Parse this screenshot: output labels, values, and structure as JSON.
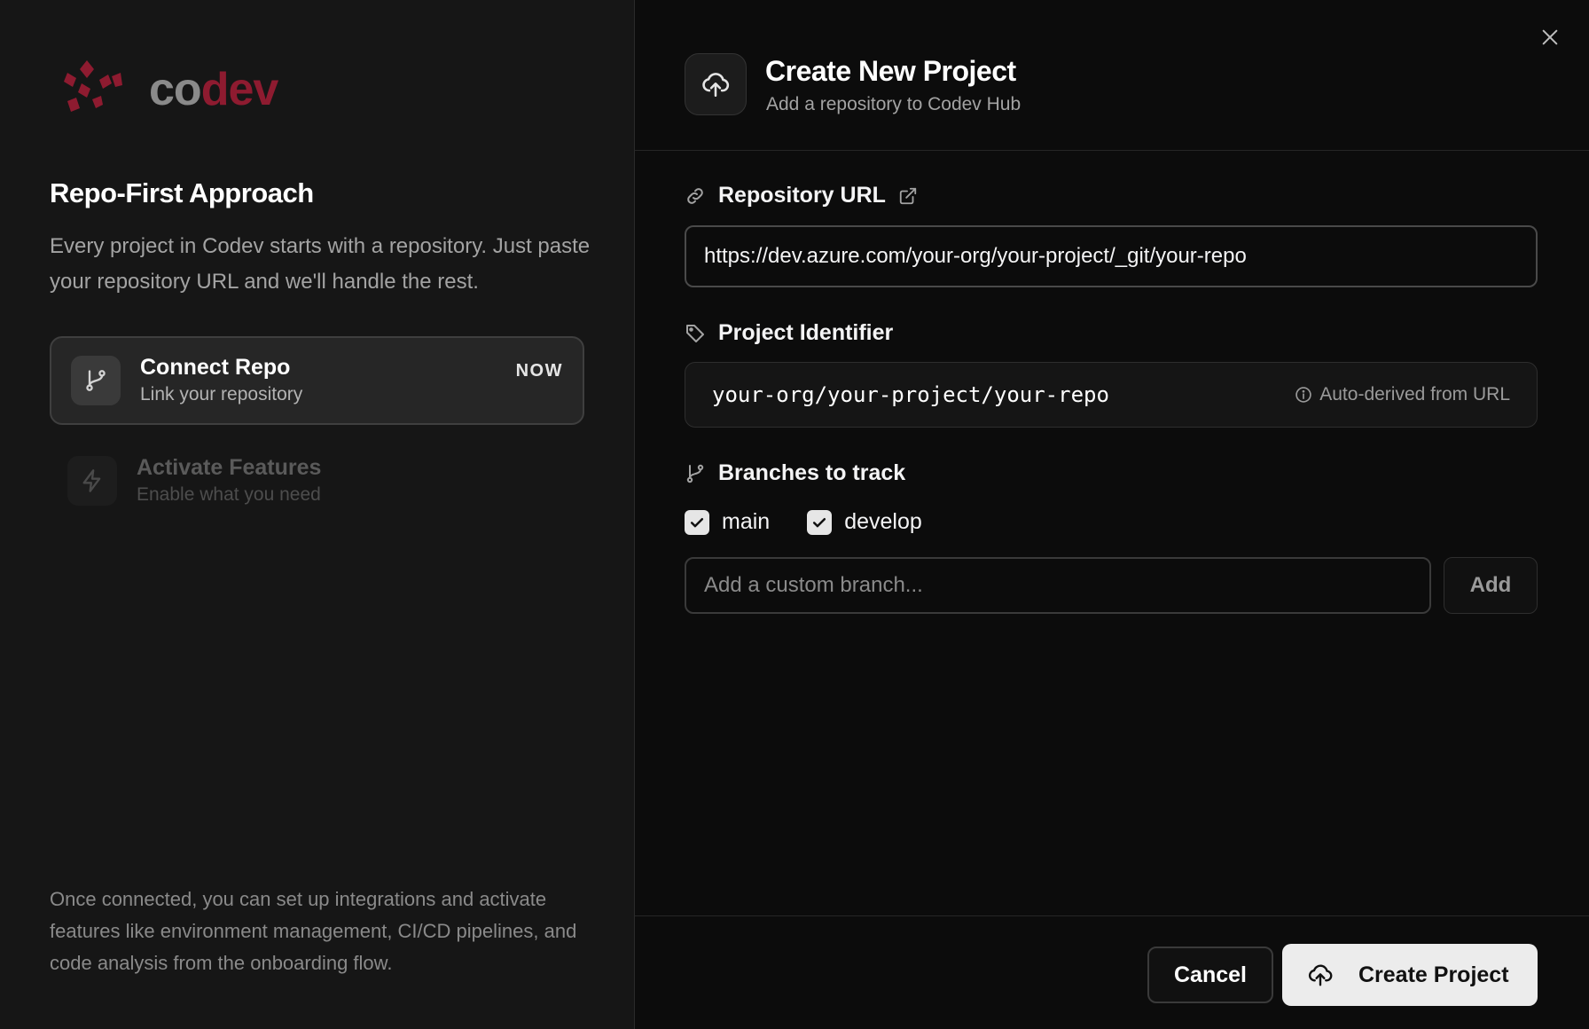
{
  "brand": {
    "logo_text_a": "co",
    "logo_text_b": "dev",
    "logo_icon": "codev-logo-icon",
    "accent_color": "#8e1b30"
  },
  "left": {
    "title": "Repo-First Approach",
    "intro": "Every project in Codev starts with a repository. Just paste your repository URL and we'll handle the rest.",
    "steps": [
      {
        "title": "Connect Repo",
        "subtitle": "Link your repository",
        "badge": "NOW",
        "icon": "git-branch-icon",
        "active": true
      },
      {
        "title": "Activate Features",
        "subtitle": "Enable what you need",
        "icon": "lightning-icon",
        "active": false
      }
    ],
    "outro": "Once connected, you can set up integrations and activate features like environment management, CI/CD pipelines, and code analysis from the onboarding flow."
  },
  "header": {
    "title": "Create New Project",
    "subtitle": "Add a repository to Codev Hub",
    "icon": "cloud-upload-icon"
  },
  "form": {
    "repo_url": {
      "label": "Repository URL",
      "value": "https://dev.azure.com/your-org/your-project/_git/your-repo",
      "icon": "link-icon",
      "external_icon": "external-link-icon"
    },
    "project_identifier": {
      "label": "Project Identifier",
      "value": "your-org/your-project/your-repo",
      "hint": "Auto-derived from URL",
      "icon": "tag-icon"
    },
    "branches": {
      "label": "Branches to track",
      "icon": "git-branch-icon",
      "options": [
        {
          "name": "main",
          "checked": true
        },
        {
          "name": "develop",
          "checked": true
        }
      ],
      "custom_placeholder": "Add a custom branch...",
      "add_label": "Add"
    }
  },
  "footer": {
    "cancel_label": "Cancel",
    "create_label": "Create Project"
  }
}
